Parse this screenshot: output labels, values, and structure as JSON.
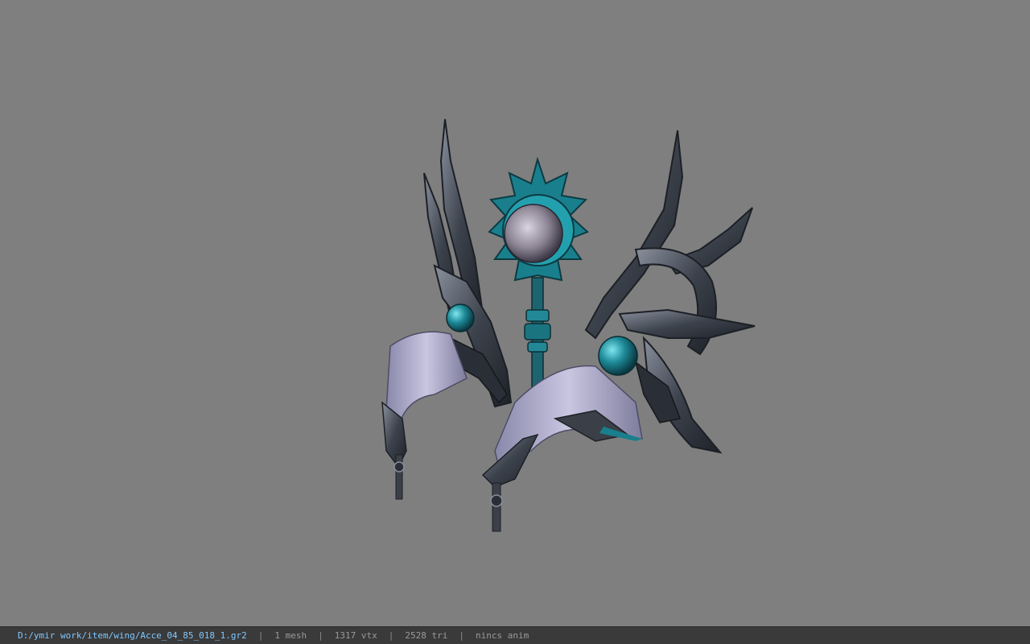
{
  "viewer": {
    "colors": {
      "background": "#808080",
      "statusbar_bg": "#3a3a3a",
      "path_text": "#7fc8ff",
      "stat_text": "#9a9a9a",
      "metal": "#4a505c",
      "teal": "#1e8a98",
      "scale": "#b6b6d4"
    }
  },
  "statusbar": {
    "file_path": "D:/ymir work/item/wing/Acce_04_85_018_1.gr2",
    "separator": "|",
    "mesh_count": "1 mesh",
    "vertex_count": "1317 vtx",
    "triangle_count": "2528 tri",
    "anim_status": "nincs anim"
  }
}
